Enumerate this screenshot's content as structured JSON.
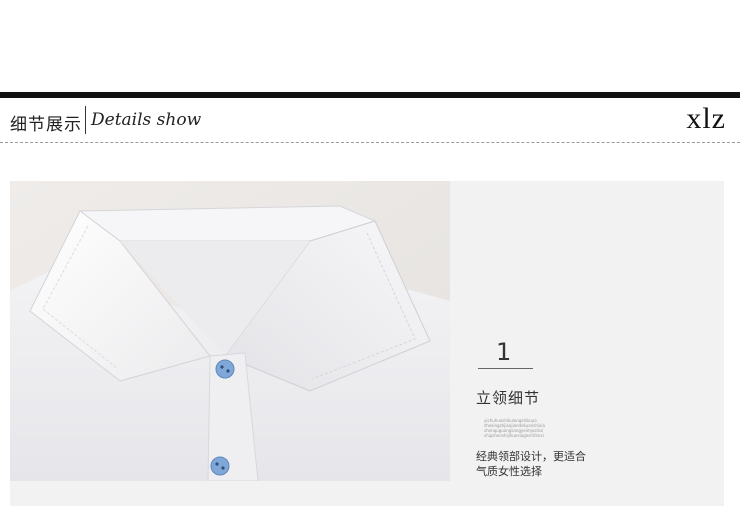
{
  "header": {
    "title_zh": "细节展示",
    "title_en": "Details show",
    "brand": "xlz"
  },
  "detail": {
    "number": "1",
    "title": "立领细节",
    "fine_print": [
      "yichuhuashikulongshikuyo",
      "zhexingzhjiaojiandekuanshixia",
      "shenquguangsangyeimjushisi",
      "shipzhenshijihuexiageshifanxi"
    ],
    "description_line1": "经典领部设计，更适合",
    "description_line2": "气质女性选择"
  },
  "colors": {
    "bar": "#111111",
    "panel": "#f2f2f2",
    "button": "#7fa8d8"
  },
  "icons": {
    "photo": "white-shirt-collar-closeup"
  }
}
